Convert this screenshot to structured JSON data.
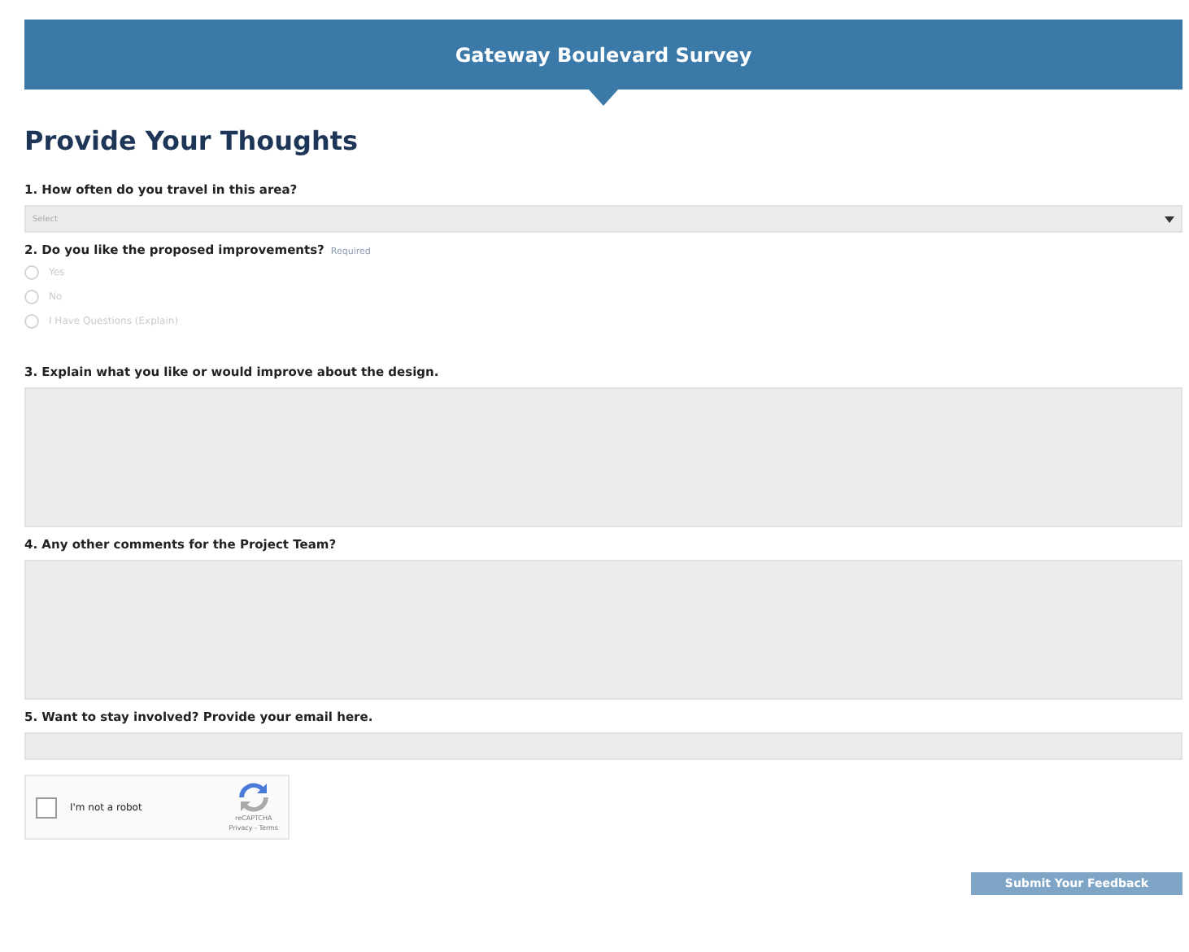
{
  "header": {
    "title": "Gateway Boulevard Survey"
  },
  "heading": "Provide Your Thoughts",
  "questions": [
    {
      "kind": "select",
      "label": "1. How often do you travel in this area?",
      "value": "Select"
    },
    {
      "kind": "radio",
      "label": "2. Do you like the proposed improvements?",
      "required": "Required",
      "options": [
        {
          "label": "Yes",
          "selected": false
        },
        {
          "label": "No",
          "selected": false
        },
        {
          "label": "I Have Questions (Explain)",
          "selected": false
        }
      ]
    },
    {
      "kind": "textarea",
      "label": "3. Explain what you like or would improve about the design."
    },
    {
      "kind": "textarea",
      "label": "4. Any other comments for the Project Team?"
    },
    {
      "kind": "text",
      "label": "5. Want to stay involved? Provide your email here."
    }
  ],
  "captcha": {
    "label": "I'm not a robot",
    "checked": false,
    "brand": "reCAPTCHA",
    "links": "Privacy - Terms"
  },
  "submit": "Submit Your Feedback"
}
